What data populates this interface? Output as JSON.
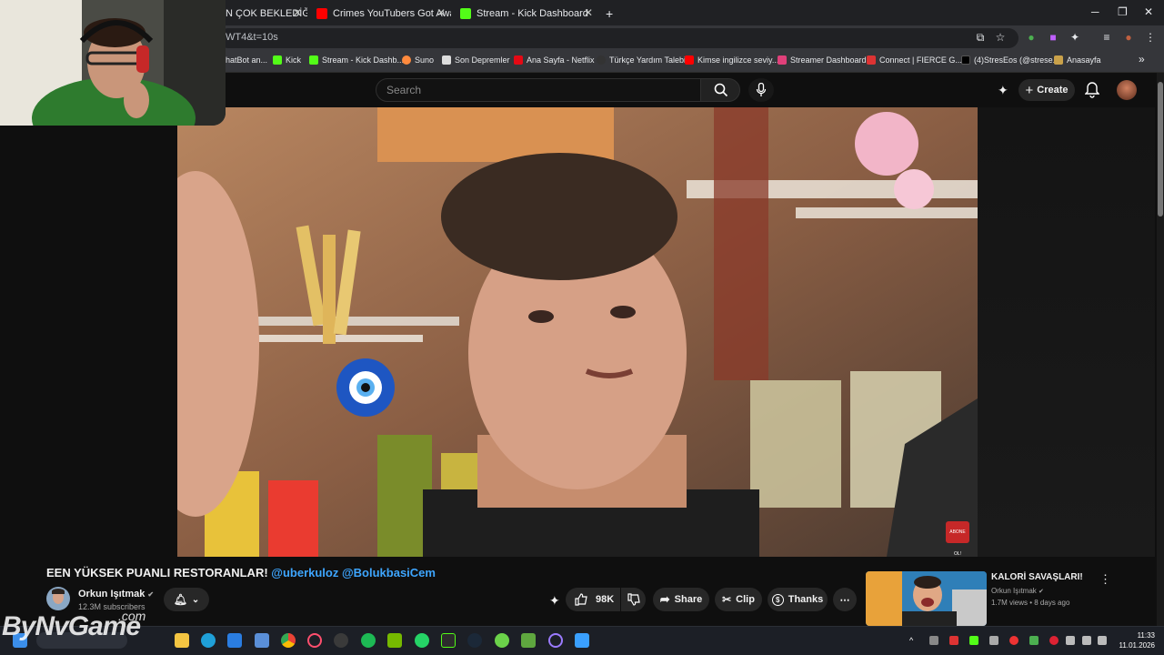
{
  "browser": {
    "tabs": [
      {
        "label": "N ÇOK BEKLEDİĞİM"
      },
      {
        "label": "Crimes YouTubers Got Away W"
      },
      {
        "label": "Stream - Kick Dashboard"
      }
    ],
    "new_tab": "+",
    "close": "✕",
    "url": "WT4&t=10s",
    "bookmarks": [
      {
        "label": "hatBot an..."
      },
      {
        "label": "Kick"
      },
      {
        "label": "Stream - Kick Dashb..."
      },
      {
        "label": "Suno"
      },
      {
        "label": "Son Depremler"
      },
      {
        "label": "Ana Sayfa - Netflix"
      },
      {
        "label": "Türkçe Yardım Talebi"
      },
      {
        "label": "Kimse ingilizce seviy..."
      },
      {
        "label": "Streamer Dashboard"
      },
      {
        "label": "Connect | FIERCE G..."
      },
      {
        "label": "(4)StresEos (@strese..."
      },
      {
        "label": "Anasayfa"
      }
    ],
    "more": "»"
  },
  "youtube": {
    "search_placeholder": "Search",
    "create_label": "Create",
    "video_title": "EEN YÜKSEK PUANLI RESTORANLAR!",
    "mention_1": "@uberkuloz",
    "mention_2": "@BolukbasiCem",
    "channel_name": "Orkun Işıtmak",
    "verified": "✔",
    "subscribers": "12.3M subscribers",
    "likes": "98K",
    "share_label": "Share",
    "clip_label": "Clip",
    "thanks_label": "Thanks",
    "more_label": "⋯",
    "sub_badge": "ABONE OL!",
    "recommended": {
      "title": "KALORİ SAVAŞLARI!",
      "channel": "Orkun Işıtmak",
      "meta": "1.7M views • 8 days ago"
    }
  },
  "taskbar": {
    "time": "11:33",
    "date": "11.01.2026"
  },
  "overlay": {
    "watermark": "ByNvGame",
    "watermark_suffix": ".com"
  }
}
